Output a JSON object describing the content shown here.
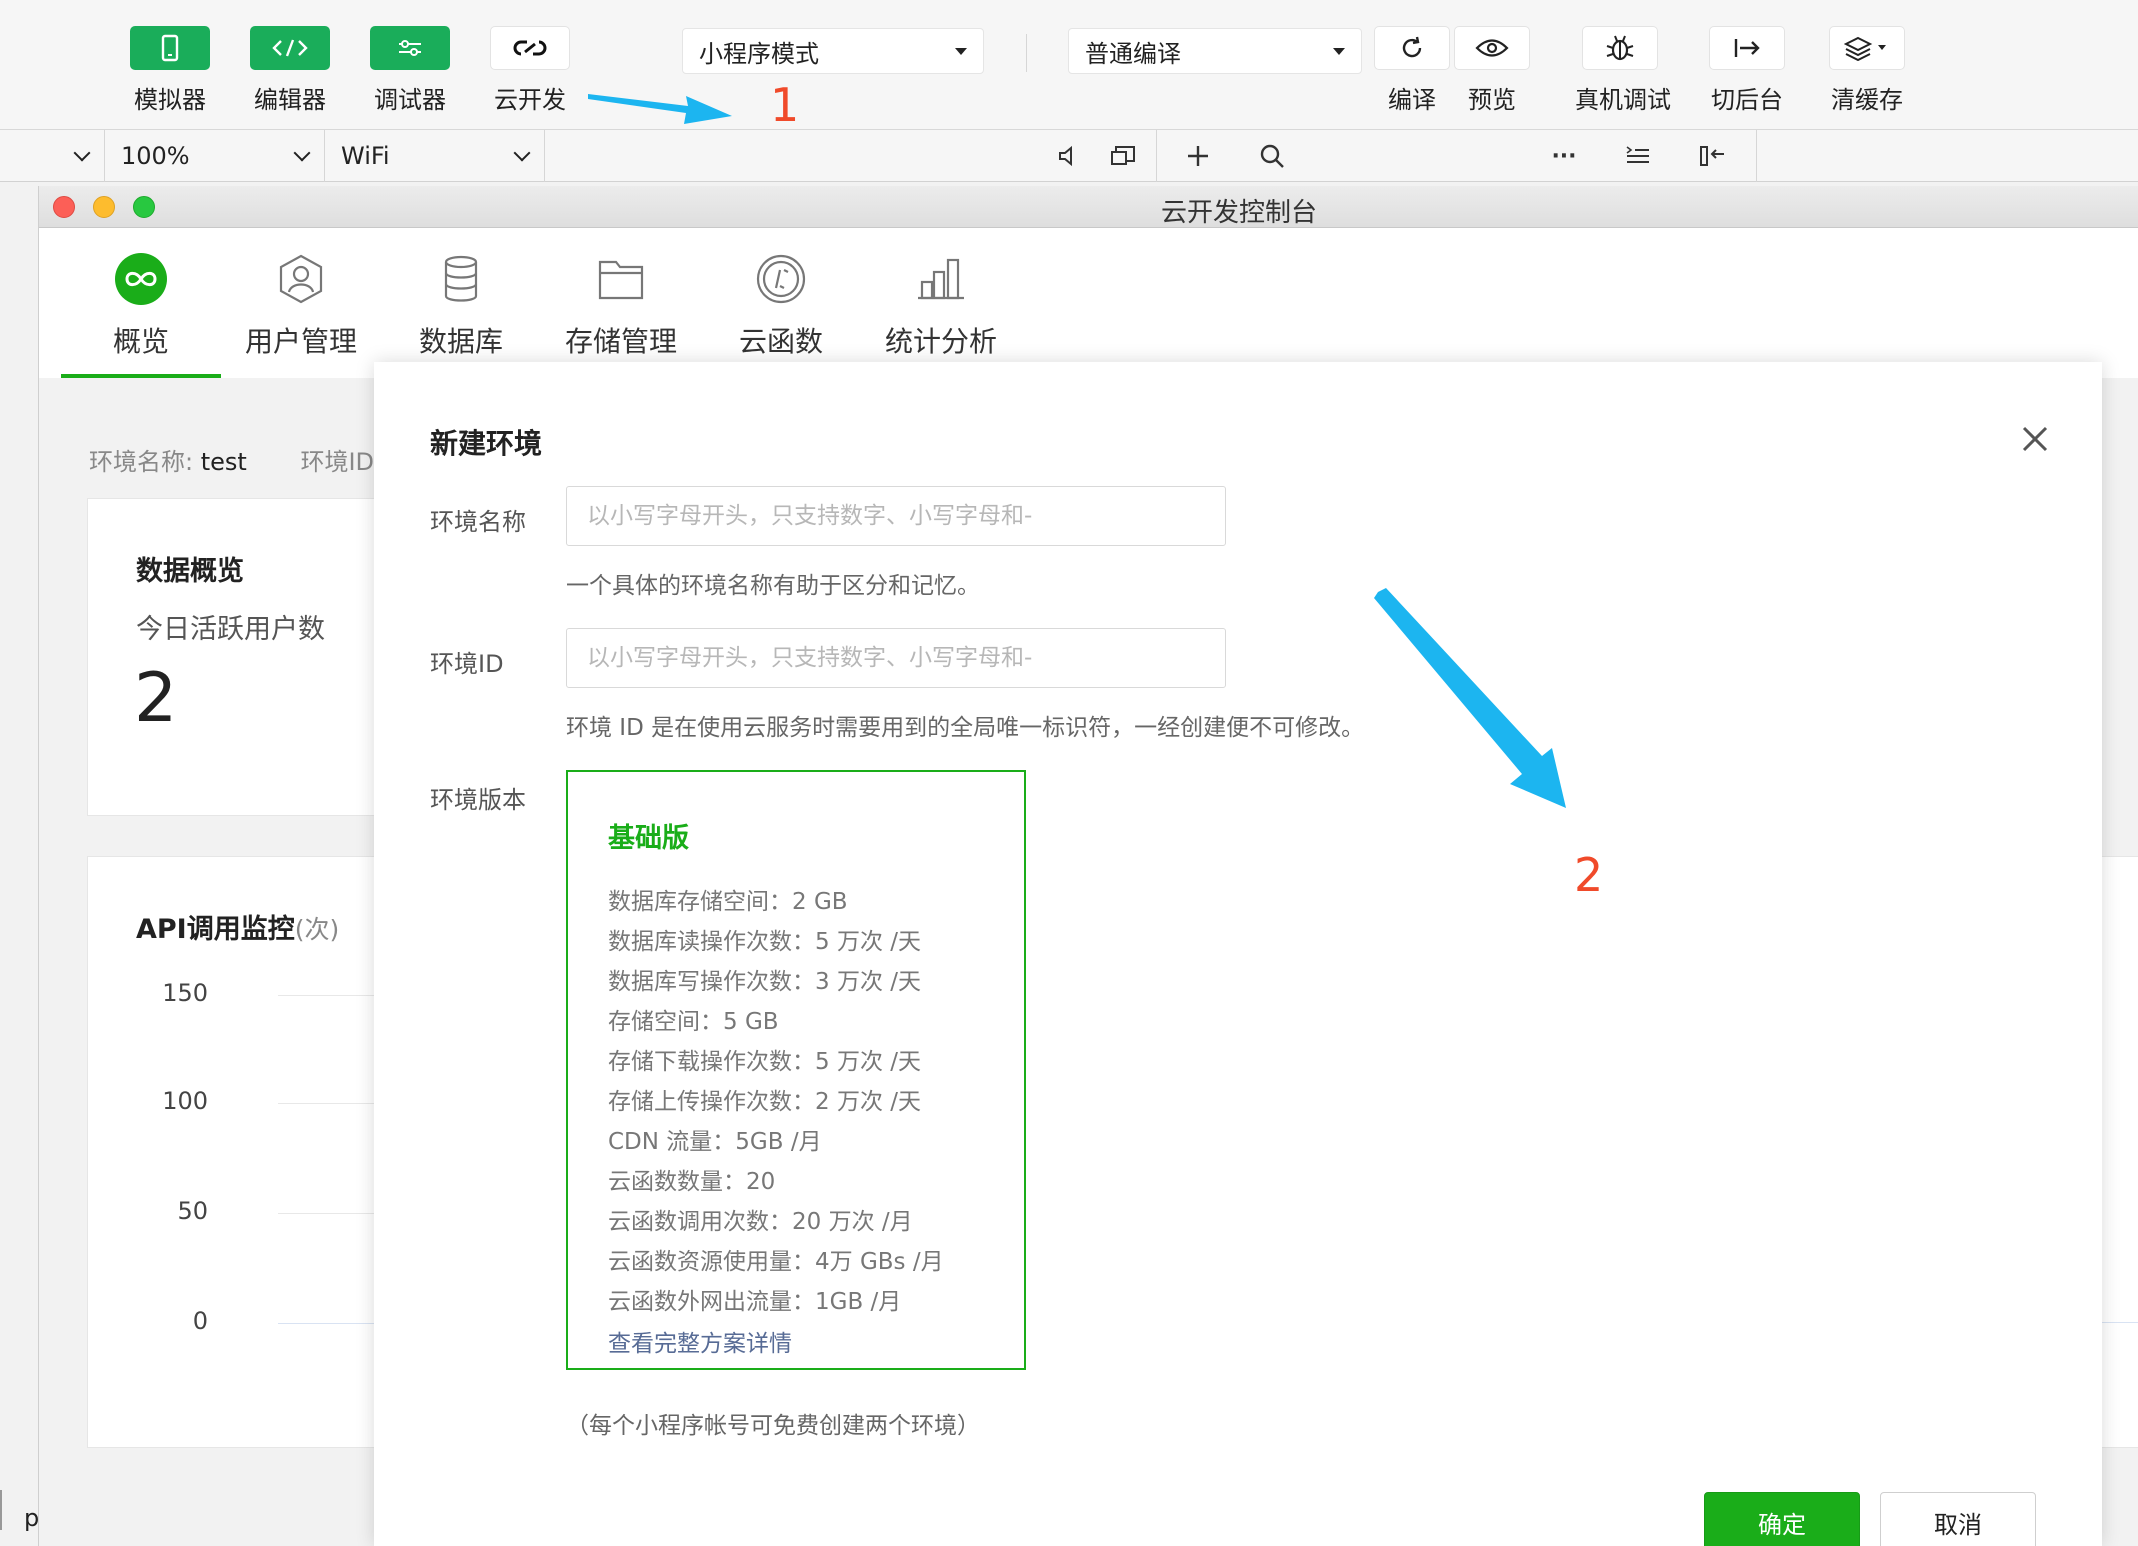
{
  "toolbar": {
    "simulator": "模拟器",
    "editor": "编辑器",
    "debugger": "调试器",
    "cloud": "云开发",
    "mode_select": "小程序模式",
    "compile_select": "普通编译",
    "compile": "编译",
    "preview": "预览",
    "real_debug": "真机调试",
    "background": "切后台",
    "clear_cache": "清缓存"
  },
  "subbar": {
    "zoom": "100%",
    "network": "WiFi",
    "more": "···"
  },
  "window": {
    "title": "云开发控制台"
  },
  "nav": {
    "items": [
      {
        "label": "概览"
      },
      {
        "label": "用户管理"
      },
      {
        "label": "数据库"
      },
      {
        "label": "存储管理"
      },
      {
        "label": "云函数"
      },
      {
        "label": "统计分析"
      }
    ]
  },
  "background_page": {
    "env_name_label": "环境名称:",
    "env_name_value": "test",
    "env_id_label": "环境ID:",
    "data_overview_title": "数据概览",
    "active_users_label": "今日活跃用户数",
    "active_users_value": "2",
    "api_title": "API调用监控",
    "api_unit": "(次)",
    "y_ticks": [
      "150",
      "100",
      "50",
      "0"
    ],
    "corner_text": "p"
  },
  "modal": {
    "title": "新建环境",
    "env_name_label": "环境名称",
    "env_name_placeholder": "以小写字母开头，只支持数字、小写字母和-",
    "env_name_hint": "一个具体的环境名称有助于区分和记忆。",
    "env_id_label": "环境ID",
    "env_id_placeholder": "以小写字母开头，只支持数字、小写字母和-",
    "env_id_hint": "环境 ID 是在使用云服务时需要用到的全局唯一标识符，一经创建便不可修改。",
    "env_version_label": "环境版本",
    "plan": {
      "title": "基础版",
      "items": [
        "数据库存储空间：2 GB",
        "数据库读操作次数：5 万次 /天",
        "数据库写操作次数：3 万次 /天",
        "存储空间：5 GB",
        "存储下载操作次数：5 万次 /天",
        "存储上传操作次数：2 万次 /天",
        "CDN 流量：5GB /月",
        "云函数数量：20",
        "云函数调用次数：20 万次 /月",
        "云函数资源使用量：4万 GBs /月",
        "云函数外网出流量：1GB /月"
      ],
      "link": "查看完整方案详情"
    },
    "note": "（每个小程序帐号可免费创建两个环境）",
    "confirm": "确定",
    "cancel": "取消"
  },
  "annotations": {
    "n1": "1",
    "n2": "2"
  },
  "colors": {
    "green": "#1aad19",
    "arrow": "#1cb5f0",
    "annotation": "#f04a2a"
  }
}
